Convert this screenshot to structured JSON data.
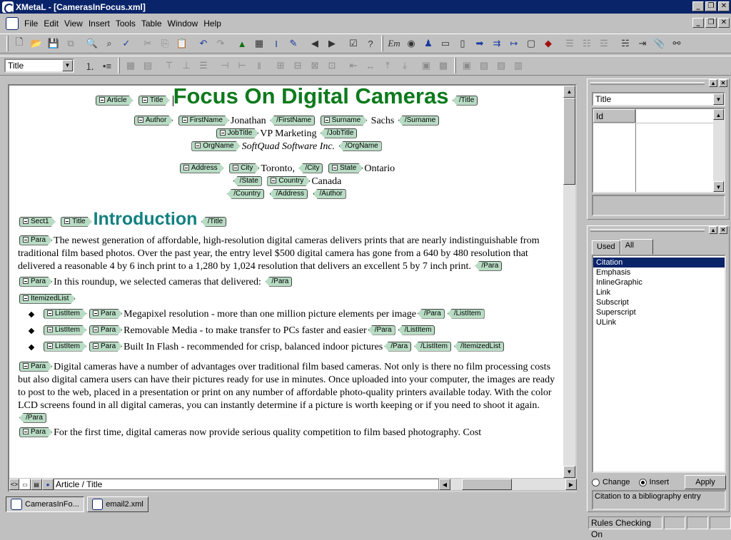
{
  "app": {
    "title": "XMetaL - [CamerasInFocus.xml]"
  },
  "menus": [
    "File",
    "Edit",
    "View",
    "Insert",
    "Tools",
    "Table",
    "Window",
    "Help"
  ],
  "toolbar": {
    "style_select": "Title",
    "em_label": "Em"
  },
  "doc": {
    "tags": {
      "article": "Article",
      "title": "Title",
      "title_close": "/Title",
      "author": "Author",
      "firstname": "FirstName",
      "firstname_close": "/FirstName",
      "surname": "Surname",
      "surname_close": "/Surname",
      "jobtitle": "JobTitle",
      "jobtitle_close": "/JobTitle",
      "orgname": "OrgName",
      "orgname_close": "/OrgName",
      "address": "Address",
      "city": "City",
      "city_close": "/City",
      "state": "State",
      "state_close": "/State",
      "country": "Country",
      "country_close": "/Country",
      "address_close": "/Address",
      "author_close": "/Author",
      "sect1": "Sect1",
      "para": "Para",
      "para_close": "/Para",
      "itemizedlist": "ItemizedList",
      "itemizedlist_close": "/ItemizedList",
      "listitem": "ListItem",
      "listitem_close": "/ListItem"
    },
    "title": "Focus On Digital Cameras",
    "firstname": "Jonathan",
    "surname": "Sachs",
    "jobtitle": "VP Marketing",
    "orgname": "SoftQuad Software Inc.",
    "city": "Toronto,",
    "state": "Ontario",
    "country": "Canada",
    "section_title": "Introduction",
    "para1": "The newest generation of affordable, high-resolution digital cameras delivers prints that are nearly indistinguishable from traditional film based photos. Over the past year, the entry level $500 digital camera has gone from a 640 by 480 resolution that delivered a reasonable 4 by 6 inch print to a 1,280 by 1,024 resolution that delivers an excellent 5 by 7 inch print.",
    "para2": "In this roundup, we selected cameras that delivered:",
    "list": [
      "Megapixel resolution - more than one million picture elements per image",
      "Removable Media - to make transfer to PCs faster and easier",
      "Built In Flash - recommended for crisp, balanced indoor pictures"
    ],
    "para3": "Digital cameras have a number of advantages over traditional film based cameras. Not only is there no film processing costs but also digital camera users can have their pictures ready for use in minutes. Once uploaded into your computer, the images are ready to post to the web, placed in a presentation or print on any number of affordable photo-quality printers available today. With the color LCD screens found in all digital cameras, you can instantly determine if a picture is worth keeping or if you need to shoot it again.",
    "para4_partial": "For the first time, digital cameras now provide serious quality competition to film based photography. Cost"
  },
  "path": "Article / Title",
  "tabs": [
    "CamerasInFo...",
    "email2.xml"
  ],
  "attr_panel": {
    "element": "Title",
    "attr_name": "Id",
    "attr_value": ""
  },
  "elem_panel": {
    "tabs": [
      "Used",
      "All"
    ],
    "items": [
      "Citation",
      "Emphasis",
      "InlineGraphic",
      "Link",
      "Subscript",
      "Superscript",
      "ULink"
    ],
    "change_label": "Change",
    "insert_label": "Insert",
    "apply_label": "Apply",
    "description": "Citation to a bibliography entry"
  },
  "status": {
    "rules": "Rules Checking On"
  }
}
